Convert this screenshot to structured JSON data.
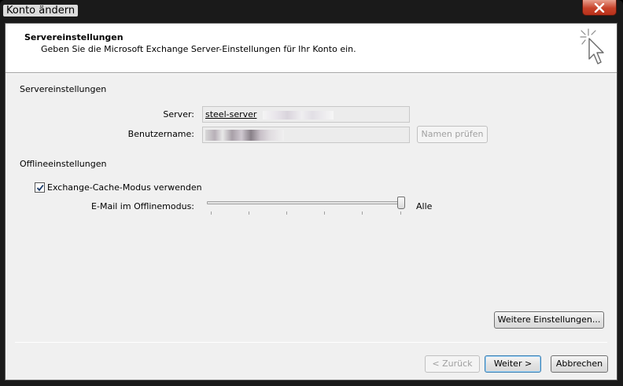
{
  "window": {
    "title": "Konto ändern"
  },
  "header": {
    "title": "Servereinstellungen",
    "subtitle": "Geben Sie die Microsoft Exchange Server-Einstellungen für Ihr Konto ein.",
    "icon": "cursor-sparkle-icon"
  },
  "server_section": {
    "label": "Servereinstellungen",
    "server_label": "Server:",
    "server_value": "steel-server",
    "username_label": "Benutzername:",
    "check_names_button": "Namen prüfen"
  },
  "offline_section": {
    "label": "Offlineeinstellungen",
    "cache_mode_label": "Exchange-Cache-Modus verwenden",
    "cache_mode_checked": true,
    "offline_mail_label": "E-Mail im Offlinemodus:",
    "offline_mail_value": "Alle",
    "slider_fraction": 1.0
  },
  "buttons": {
    "more_settings": "Weitere Einstellungen...",
    "back": "< Zurück",
    "next": "Weiter >",
    "cancel": "Abbrechen"
  },
  "colors": {
    "dialog_bg": "#f0f0f0",
    "header_bg": "#ffffff",
    "close_button": "#c7422a"
  }
}
